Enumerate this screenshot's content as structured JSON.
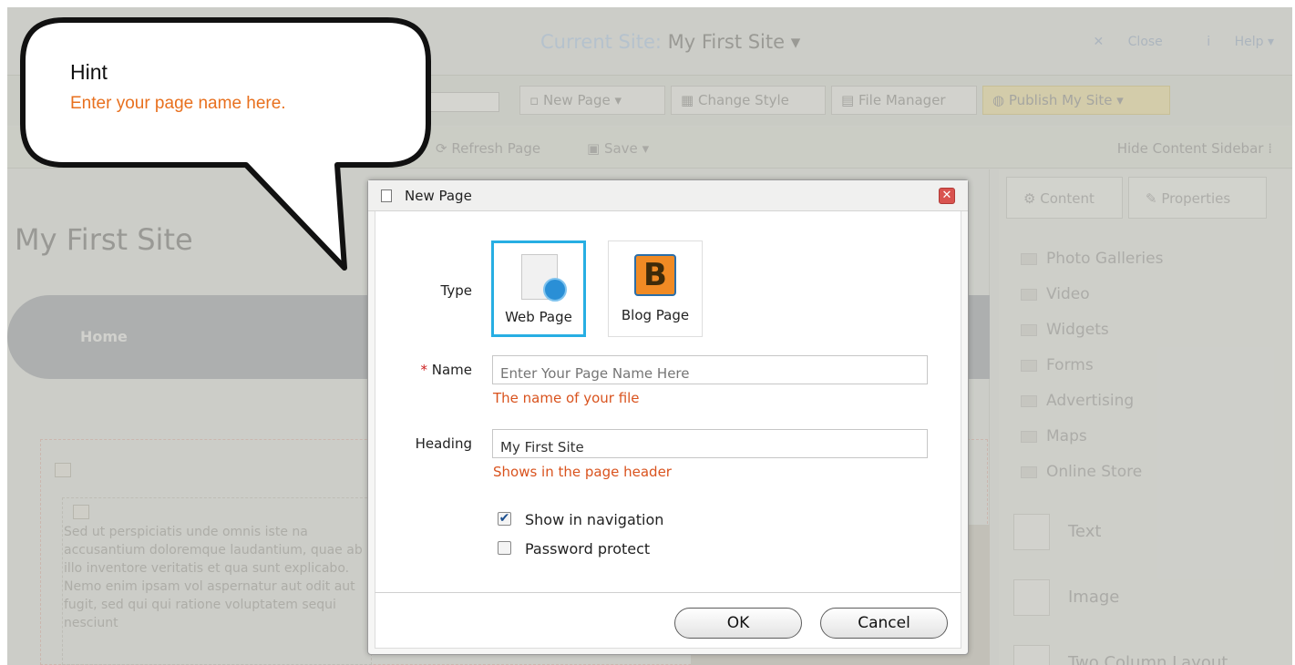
{
  "app": {
    "current_site_label": "Current Site:",
    "current_site_name": "My First Site",
    "close_label": "Close",
    "help_label": "Help"
  },
  "toolbar": {
    "new_page": "New Page",
    "change_style": "Change Style",
    "file_manager": "File Manager",
    "publish": "Publish My Site",
    "refresh_page": "Refresh Page",
    "save": "Save",
    "hide_sidebar": "Hide Content Sidebar"
  },
  "page": {
    "site_title": "My First Site",
    "nav_home": "Home",
    "lorem": "Sed ut perspiciatis unde omnis iste na accusantium doloremque laudantium, quae ab illo inventore veritatis et qua sunt explicabo. Nemo enim ipsam vol aspernatur aut odit aut fugit, sed qui qui ratione voluptatem sequi nesciunt"
  },
  "sidebar": {
    "tabs": [
      {
        "label": "Content"
      },
      {
        "label": "Properties"
      }
    ],
    "folders": [
      {
        "label": "Photo Galleries"
      },
      {
        "label": "Video"
      },
      {
        "label": "Widgets"
      },
      {
        "label": "Forms"
      },
      {
        "label": "Advertising"
      },
      {
        "label": "Maps"
      },
      {
        "label": "Online Store"
      }
    ],
    "blocks": [
      {
        "label": "Text"
      },
      {
        "label": "Image"
      },
      {
        "label": "Two Column Layout"
      }
    ]
  },
  "dialog": {
    "title": "New Page",
    "type_label": "Type",
    "types": [
      {
        "label": "Web Page",
        "selected": true
      },
      {
        "label": "Blog Page",
        "selected": false
      }
    ],
    "required_mark": "*",
    "name_label": "Name",
    "name_placeholder": "Enter Your Page Name Here",
    "name_hint": "The name of your file",
    "heading_label": "Heading",
    "heading_value": "My First Site",
    "heading_hint": "Shows in the page header",
    "show_in_nav_label": "Show in navigation",
    "show_in_nav_checked": true,
    "password_protect_label": "Password protect",
    "password_protect_checked": false,
    "ok_label": "OK",
    "cancel_label": "Cancel"
  },
  "hint_bubble": {
    "title": "Hint",
    "body": "Enter your page name here."
  },
  "colors": {
    "accent_orange": "#d9531e",
    "selection_blue": "#27aee3",
    "required_red": "#cc1f1f"
  }
}
